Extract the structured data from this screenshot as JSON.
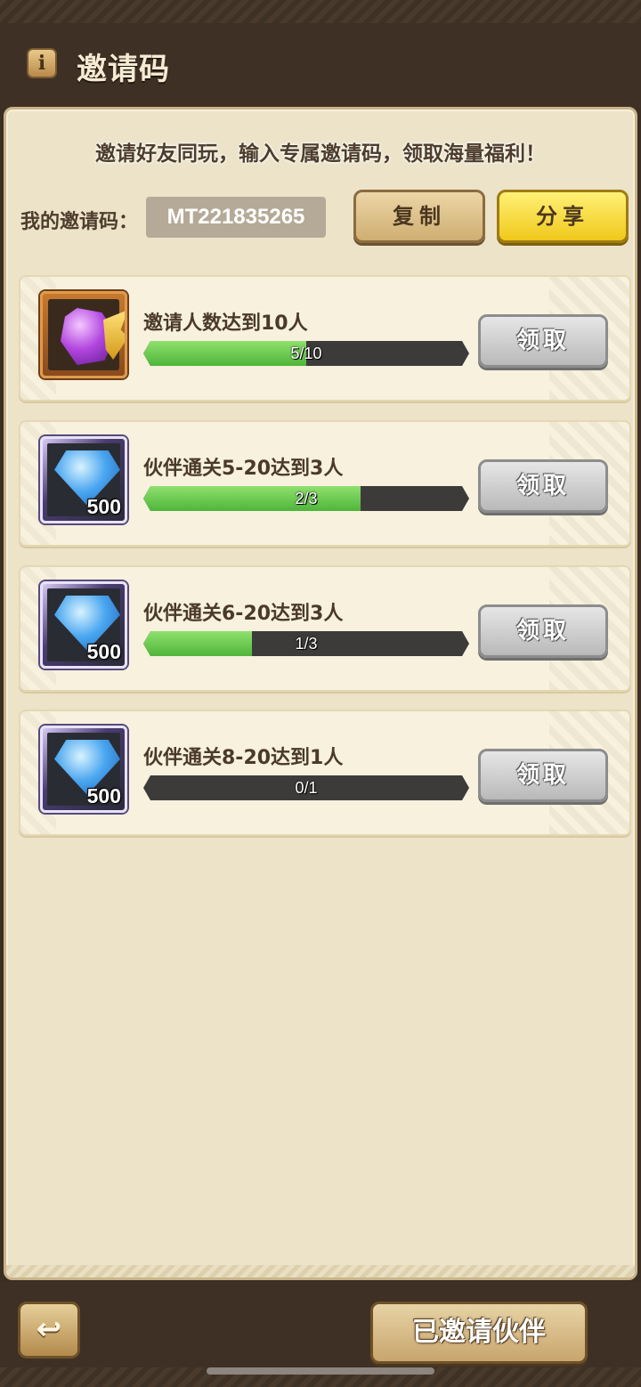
{
  "header": {
    "title": "邀请码",
    "info_icon": "i"
  },
  "notice": "邀请好友同玩，输入专属邀请码，领取海量福利！",
  "invite": {
    "label": "我的邀请码：",
    "code": "MT221835265",
    "copy_label": "复制",
    "share_label": "分享"
  },
  "tasks": [
    {
      "title": "邀请人数达到10人",
      "progress_text": "5/10",
      "progress": 0.5,
      "reward_icon": "purple-gem-icon",
      "reward_qty": "",
      "claim_label": "领取"
    },
    {
      "title": "伙伴通关5-20达到3人",
      "progress_text": "2/3",
      "progress": 0.667,
      "reward_icon": "blue-diamond-icon",
      "reward_qty": "500",
      "claim_label": "领取"
    },
    {
      "title": "伙伴通关6-20达到3人",
      "progress_text": "1/3",
      "progress": 0.333,
      "reward_icon": "blue-diamond-icon",
      "reward_qty": "500",
      "claim_label": "领取"
    },
    {
      "title": "伙伴通关8-20达到1人",
      "progress_text": "0/1",
      "progress": 0,
      "reward_icon": "blue-diamond-icon",
      "reward_qty": "500",
      "claim_label": "领取"
    }
  ],
  "footer": {
    "back_icon": "↩",
    "invited_label": "已邀请伙伴"
  }
}
